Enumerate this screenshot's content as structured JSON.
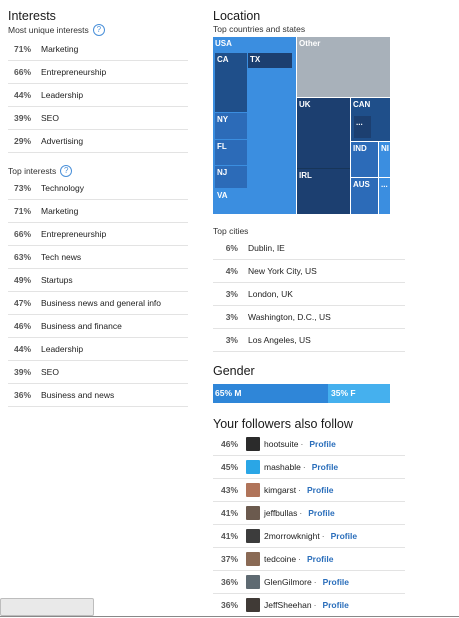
{
  "interests": {
    "title": "Interests",
    "unique_sub": "Most unique interests",
    "unique": [
      {
        "pct": "71%",
        "label": "Marketing"
      },
      {
        "pct": "66%",
        "label": "Entrepreneurship"
      },
      {
        "pct": "44%",
        "label": "Leadership"
      },
      {
        "pct": "39%",
        "label": "SEO"
      },
      {
        "pct": "29%",
        "label": "Advertising"
      }
    ],
    "top_sub": "Top interests",
    "top": [
      {
        "pct": "73%",
        "label": "Technology"
      },
      {
        "pct": "71%",
        "label": "Marketing"
      },
      {
        "pct": "66%",
        "label": "Entrepreneurship"
      },
      {
        "pct": "63%",
        "label": "Tech news"
      },
      {
        "pct": "49%",
        "label": "Startups"
      },
      {
        "pct": "47%",
        "label": "Business news and general info"
      },
      {
        "pct": "46%",
        "label": "Business and finance"
      },
      {
        "pct": "44%",
        "label": "Leadership"
      },
      {
        "pct": "39%",
        "label": "SEO"
      },
      {
        "pct": "36%",
        "label": "Business and news"
      }
    ],
    "help_glyph": "?"
  },
  "location": {
    "title": "Location",
    "sub": "Top countries and states",
    "treemap_labels": {
      "usa": "USA",
      "ca": "CA",
      "tx": "TX",
      "ny": "NY",
      "fl": "FL",
      "nj": "NJ",
      "va": "VA",
      "other": "Other",
      "uk": "UK",
      "can": "CAN",
      "can_more": "...",
      "irl": "IRL",
      "ind": "IND",
      "ni": "NI",
      "aus": "AUS",
      "aus_more": "..."
    },
    "cities_sub": "Top cities",
    "cities": [
      {
        "pct": "6%",
        "label": "Dublin, IE"
      },
      {
        "pct": "4%",
        "label": "New York City, US"
      },
      {
        "pct": "3%",
        "label": "London, UK"
      },
      {
        "pct": "3%",
        "label": "Washington, D.C., US"
      },
      {
        "pct": "3%",
        "label": "Los Angeles, US"
      }
    ]
  },
  "gender": {
    "title": "Gender",
    "male_label": "65% M",
    "female_label": "35% F",
    "male_share": 0.65
  },
  "follow": {
    "title": "Your followers also follow",
    "profile_label": "Profile",
    "separator": "·",
    "accounts": [
      {
        "pct": "46%",
        "name": "hootsuite",
        "avatar_color": "#2b2b2b"
      },
      {
        "pct": "45%",
        "name": "mashable",
        "avatar_color": "#2aa6e6"
      },
      {
        "pct": "43%",
        "name": "kimgarst",
        "avatar_color": "#b0745a"
      },
      {
        "pct": "41%",
        "name": "jeffbullas",
        "avatar_color": "#6b5a4e"
      },
      {
        "pct": "41%",
        "name": "2morrowknight",
        "avatar_color": "#3c3c3c"
      },
      {
        "pct": "37%",
        "name": "tedcoine",
        "avatar_color": "#8a6a55"
      },
      {
        "pct": "36%",
        "name": "GlenGilmore",
        "avatar_color": "#5e6a72"
      },
      {
        "pct": "36%",
        "name": "JeffSheehan",
        "avatar_color": "#403a36"
      }
    ]
  }
}
